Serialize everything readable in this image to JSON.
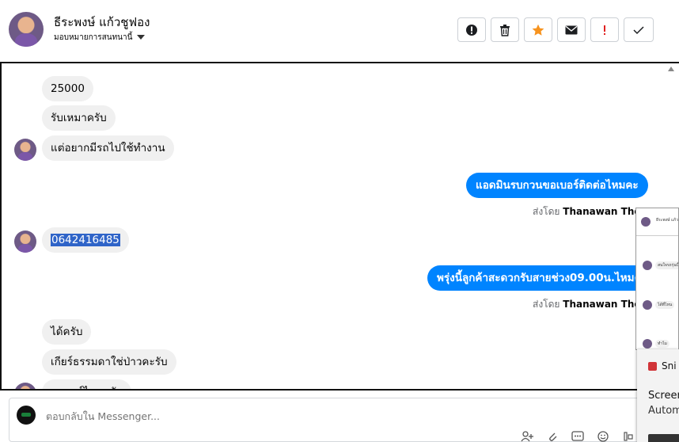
{
  "header": {
    "name": "ธีระพงษ์ แก้วชูฟอง",
    "assign_label": "มอบหมายการสนทนานี้",
    "toolbar": [
      {
        "icon": "alert-circle-icon",
        "color": "#1c1e21"
      },
      {
        "icon": "trash-icon",
        "color": "#1c1e21"
      },
      {
        "icon": "star-icon",
        "color": "#f7931e"
      },
      {
        "icon": "envelope-icon",
        "color": "#1c1e21"
      },
      {
        "icon": "exclamation-icon",
        "color": "#e02020"
      },
      {
        "icon": "check-icon",
        "color": "#1c1e21"
      }
    ]
  },
  "messages": [
    {
      "dir": "in",
      "text": "25000"
    },
    {
      "dir": "in",
      "text": "รับเหมาครับ"
    },
    {
      "dir": "in",
      "text": "แต่อยากมีรถไปใช้ทำงาน"
    },
    {
      "dir": "out",
      "text": "แอดมินรบกวนขอเบอร์ติดต่อไหมคะ"
    },
    {
      "sent_by_prefix": "ส่งโดย",
      "sent_by_name": "Thanawan Thon"
    },
    {
      "dir": "in",
      "text": "0642416485"
    },
    {
      "dir": "out",
      "text": "พรุ่งนี้ลูกค้าสะดวกรับสายช่วง09.00น.ไหมคะ"
    },
    {
      "sent_by_prefix": "ส่งโดย",
      "sent_by_name": "Thanawan Thon"
    },
    {
      "dir": "in",
      "text": "ได้ครับ"
    },
    {
      "dir": "in",
      "text": "เกียร์ธรรมดาใช่ป่าวคะรับ"
    },
    {
      "dir": "in",
      "text": "รถยนต์ไหนครับ"
    }
  ],
  "reply": {
    "placeholder": "ตอบกลับใน Messenger..."
  },
  "overlay_thumb": {
    "bubbles": [
      "ธีระพงษ์ แก้วชูฟอง",
      "สนใจรถรุ่นนี้",
      "ได้ที่ไหน",
      "ทำไม"
    ]
  },
  "toast": {
    "app": "Sni",
    "title": "Screen",
    "body": "Autom"
  },
  "colors": {
    "outgoing_bubble": "#0084ff",
    "incoming_bubble": "#f0f0f0"
  }
}
